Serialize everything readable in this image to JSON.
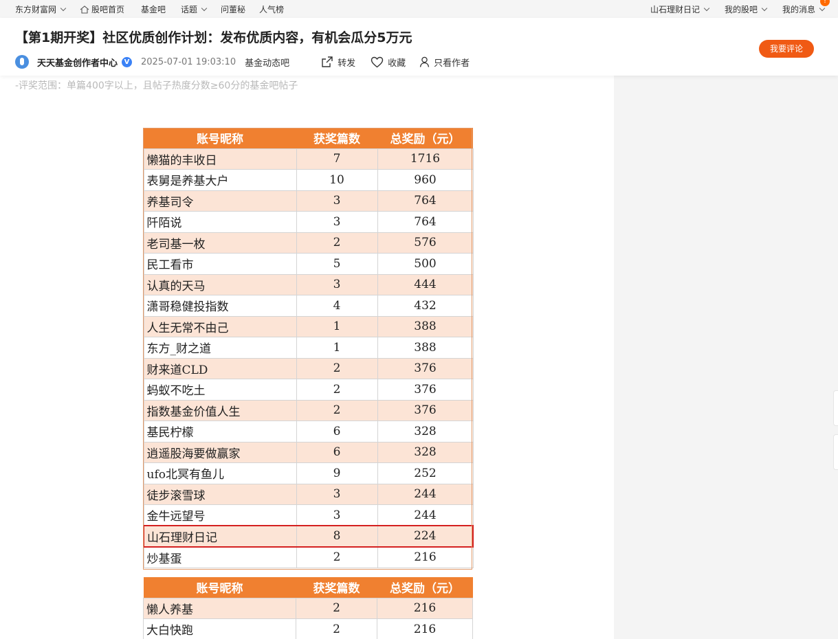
{
  "topnav": {
    "site": "东方财富网",
    "home": "股吧首页",
    "fund_bar": "基金吧",
    "topics": "话题",
    "ask_dongmi": "问董秘",
    "popular": "人气榜",
    "user": "山石理财日记",
    "my_bars": "我的股吧",
    "my_messages": "我的消息"
  },
  "post": {
    "title": "【第1期开奖】社区优质创作计划：发布优质内容，有机会瓜分5万元",
    "author": "天天基金创作者中心",
    "verified_mark": "V",
    "date": "2025-07-01 19:03:10",
    "bar": "基金动态吧",
    "share_label": "转发",
    "favorite_label": "收藏",
    "author_only_label": "只看作者",
    "comment_button": "我要评论",
    "rule_text": "-评奖范围：单篇400字以上，且帖子热度分数≥60分的基金吧帖子"
  },
  "award_table": {
    "headers": [
      "账号昵称",
      "获奖篇数",
      "总奖励（元）"
    ],
    "rows": [
      {
        "name": "懒猫的丰收日",
        "count": "7",
        "reward": "1716"
      },
      {
        "name": "表舅是养基大户",
        "count": "10",
        "reward": "960"
      },
      {
        "name": "养基司令",
        "count": "3",
        "reward": "764"
      },
      {
        "name": "阡陌说",
        "count": "3",
        "reward": "764"
      },
      {
        "name": "老司基一枚",
        "count": "2",
        "reward": "576"
      },
      {
        "name": "民工看市",
        "count": "5",
        "reward": "500"
      },
      {
        "name": "认真的天马",
        "count": "3",
        "reward": "444"
      },
      {
        "name": "潇哥稳健投指数",
        "count": "4",
        "reward": "432"
      },
      {
        "name": "人生无常不由己",
        "count": "1",
        "reward": "388"
      },
      {
        "name": "东方_财之道",
        "count": "1",
        "reward": "388"
      },
      {
        "name": "财来道CLD",
        "count": "2",
        "reward": "376"
      },
      {
        "name": "蚂蚁不吃土",
        "count": "2",
        "reward": "376"
      },
      {
        "name": "指数基金价值人生",
        "count": "2",
        "reward": "376"
      },
      {
        "name": "基民柠檬",
        "count": "6",
        "reward": "328"
      },
      {
        "name": "逍遥股海要做赢家",
        "count": "6",
        "reward": "328"
      },
      {
        "name": "ufo北冥有鱼儿",
        "count": "9",
        "reward": "252"
      },
      {
        "name": "徒步滚雪球",
        "count": "3",
        "reward": "244"
      },
      {
        "name": "金牛远望号",
        "count": "3",
        "reward": "244"
      },
      {
        "name": "山石理财日记",
        "count": "8",
        "reward": "224",
        "highlighted": true
      },
      {
        "name": "炒基蛋",
        "count": "2",
        "reward": "216"
      }
    ]
  },
  "award_table_2": {
    "headers": [
      "账号昵称",
      "获奖篇数",
      "总奖励（元）"
    ],
    "rows": [
      {
        "name": "懒人养基",
        "count": "2",
        "reward": "216"
      },
      {
        "name": "大白快跑",
        "count": "2",
        "reward": "216"
      }
    ]
  },
  "colors": {
    "header_orange": "#f08030",
    "row_stripe": "#fce4d6",
    "highlight_red": "#d42020",
    "comment_button": "#f05a14"
  }
}
